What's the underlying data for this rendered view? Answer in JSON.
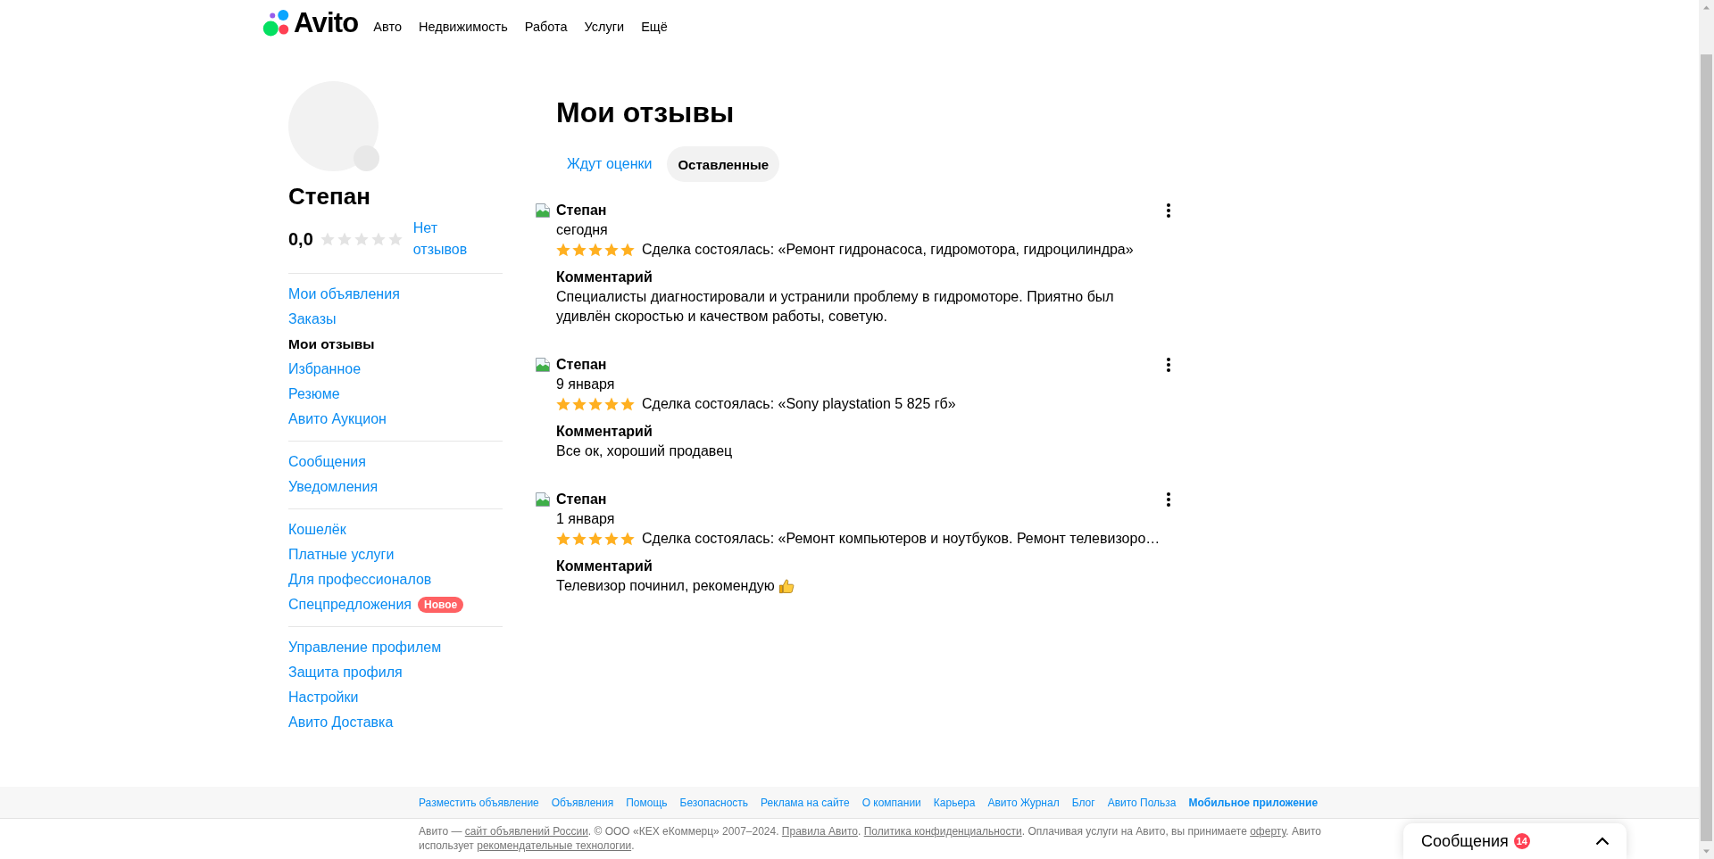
{
  "header": {
    "logo": "Avito",
    "nav": [
      "Авто",
      "Недвижимость",
      "Работа",
      "Услуги",
      "Ещё"
    ]
  },
  "profile": {
    "name": "Степан",
    "rating": "0,0",
    "stars": 0,
    "reviews_link": "Нет отзывов"
  },
  "sidebar": {
    "sections": [
      {
        "items": [
          {
            "label": "Мои объявления",
            "selected": false
          },
          {
            "label": "Заказы",
            "selected": false
          },
          {
            "label": "Мои отзывы",
            "selected": true
          },
          {
            "label": "Избранное",
            "selected": false
          },
          {
            "label": "Резюме",
            "selected": false
          },
          {
            "label": "Авито Аукцион",
            "selected": false
          }
        ]
      },
      {
        "items": [
          {
            "label": "Сообщения",
            "selected": false
          },
          {
            "label": "Уведомления",
            "selected": false
          }
        ]
      },
      {
        "items": [
          {
            "label": "Кошелёк",
            "selected": false
          },
          {
            "label": "Платные услуги",
            "selected": false
          },
          {
            "label": "Для профессионалов",
            "selected": false
          },
          {
            "label": "Спецпредложения",
            "selected": false,
            "badge": "Новое"
          }
        ]
      },
      {
        "items": [
          {
            "label": "Управление профилем",
            "selected": false
          },
          {
            "label": "Защита профиля",
            "selected": false
          },
          {
            "label": "Настройки",
            "selected": false
          },
          {
            "label": "Авито Доставка",
            "selected": false
          }
        ]
      }
    ]
  },
  "main": {
    "title": "Мои отзывы",
    "tabs": [
      {
        "label": "Ждут оценки",
        "selected": false
      },
      {
        "label": "Оставленные",
        "selected": true
      }
    ]
  },
  "reviews": [
    {
      "author": "Степан",
      "date": "сегодня",
      "stars": 5,
      "deal": "Сделка состоялась: «Ремонт гидронасоса, гидромотора, гидроцилиндра»",
      "comment_heading": "Комментарий",
      "comment": "Специалисты диагностировали и устранили проблему в гидромоторе. Приятно был удивлён скоростью и качеством работы, советую.",
      "thumbs_up": false
    },
    {
      "author": "Степан",
      "date": "9 января",
      "stars": 5,
      "deal": "Сделка состоялась: «Sony playstation 5 825 гб»",
      "comment_heading": "Комментарий",
      "comment": "Все ок, хороший продавец",
      "thumbs_up": false
    },
    {
      "author": "Степан",
      "date": "1 января",
      "stars": 5,
      "deal": "Сделка состоялась: «Ремонт компьютеров и ноутбуков. Ремонт телевизоро…",
      "comment_heading": "Комментарий",
      "comment": "Телевизор починил, рекомендую",
      "thumbs_up": true
    }
  ],
  "footer": {
    "links": [
      {
        "label": "Разместить объявление",
        "emphasized": false
      },
      {
        "label": "Объявления",
        "emphasized": false
      },
      {
        "label": "Помощь",
        "emphasized": false
      },
      {
        "label": "Безопасность",
        "emphasized": false
      },
      {
        "label": "Реклама на сайте",
        "emphasized": false
      },
      {
        "label": "О компании",
        "emphasized": false
      },
      {
        "label": "Карьера",
        "emphasized": false
      },
      {
        "label": "Авито Журнал",
        "emphasized": false
      },
      {
        "label": "Блог",
        "emphasized": false
      },
      {
        "label": "Авито Польза",
        "emphasized": false
      },
      {
        "label": "Мобильное приложение",
        "emphasized": true
      }
    ],
    "notice": [
      {
        "kind": "text",
        "text": "Авито — "
      },
      {
        "kind": "link",
        "text": "сайт объявлений России"
      },
      {
        "kind": "text",
        "text": ". © ООО «КЕХ еКоммерц» 2007–2024. "
      },
      {
        "kind": "link",
        "text": "Правила Авито"
      },
      {
        "kind": "text",
        "text": ". "
      },
      {
        "kind": "link",
        "text": "Политика конфиденциальности"
      },
      {
        "kind": "text",
        "text": ". Оплачивая услуги на Авито, вы принимаете "
      },
      {
        "kind": "link",
        "text": "оферту"
      },
      {
        "kind": "text",
        "text": ". Авито использует "
      },
      {
        "kind": "link",
        "text": "рекомендательные технологии"
      },
      {
        "kind": "text",
        "text": "."
      }
    ]
  },
  "messages_widget": {
    "label": "Сообщения",
    "count": "14"
  }
}
